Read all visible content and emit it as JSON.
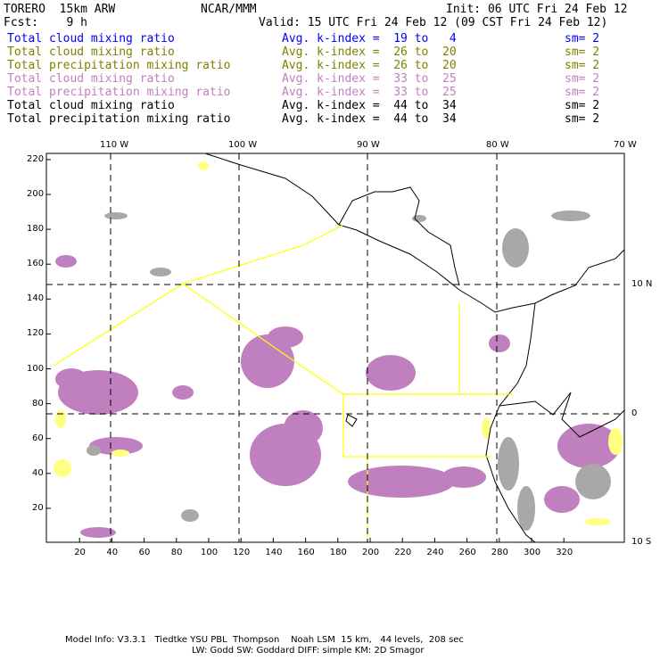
{
  "header": {
    "model": "TORERO  15km ARW",
    "org": "NCAR/MMM",
    "init": "Init: 06 UTC Fri 24 Feb 12",
    "fcst": "Fcst:    9 h",
    "valid": "Valid: 15 UTC Fri 24 Feb 12 (09 CST Fri 24 Feb 12)"
  },
  "legend": [
    {
      "field": "Total cloud mixing ratio",
      "kindex": "Avg. k-index =  19 to   4",
      "sm": "sm= 2",
      "color": "#0000ff"
    },
    {
      "field": "Total cloud mixing ratio",
      "kindex": "Avg. k-index =  26 to  20",
      "sm": "sm= 2",
      "color": "#808000"
    },
    {
      "field": "Total precipitation mixing ratio",
      "kindex": "Avg. k-index =  26 to  20",
      "sm": "sm= 2",
      "color": "#808000"
    },
    {
      "field": "Total cloud mixing ratio",
      "kindex": "Avg. k-index =  33 to  25",
      "sm": "sm= 2",
      "color": "#c080c0"
    },
    {
      "field": "Total precipitation mixing ratio",
      "kindex": "Avg. k-index =  33 to  25",
      "sm": "sm= 2",
      "color": "#c080c0"
    },
    {
      "field": "Total cloud mixing ratio",
      "kindex": "Avg. k-index =  44 to  34",
      "sm": "sm= 2",
      "color": "#000000"
    },
    {
      "field": "Total precipitation mixing ratio",
      "kindex": "Avg. k-index =  44 to  34",
      "sm": "sm= 2",
      "color": "#000000"
    }
  ],
  "axes": {
    "x_ticks": [
      "20",
      "40",
      "60",
      "80",
      "100",
      "120",
      "140",
      "160",
      "180",
      "200",
      "220",
      "240",
      "260",
      "280",
      "300",
      "320"
    ],
    "y_ticks": [
      "20",
      "40",
      "60",
      "80",
      "100",
      "120",
      "140",
      "160",
      "180",
      "200",
      "220"
    ],
    "lon_labels": [
      "110 W",
      "100 W",
      "90 W",
      "80 W",
      "70 W"
    ],
    "lat_labels": [
      "10 N",
      "0",
      "10 S"
    ]
  },
  "footer": {
    "line1": "Model Info: V3.3.1   Tiedtke YSU PBL  Thompson    Noah LSM  15 km,   44 levels,  208 sec",
    "line2": "LW: Godd SW: Goddard DIFF: simple KM: 2D Smagor"
  },
  "colors": {
    "purple": "#c080c0",
    "gray": "#a0a0a0",
    "yellow": "#ffff00",
    "lightblue": "#c8e8f8"
  }
}
